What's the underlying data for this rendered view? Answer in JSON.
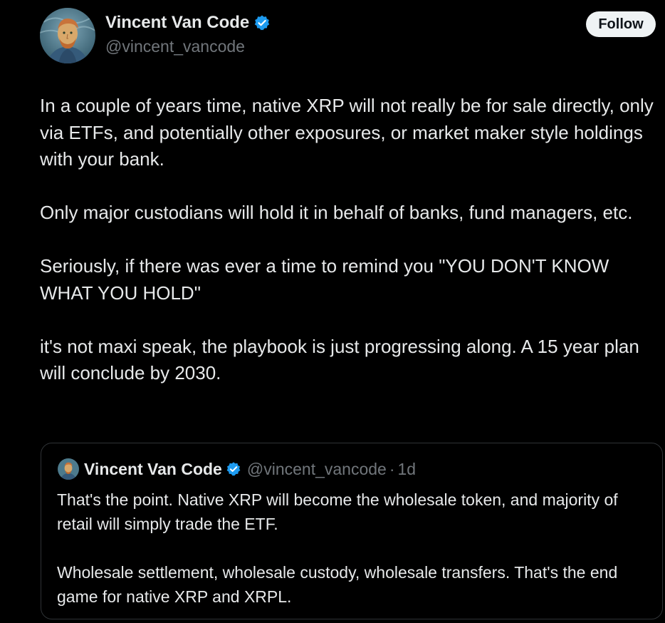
{
  "author": {
    "name": "Vincent Van Code",
    "handle": "@vincent_vancode",
    "verified_icon": "verified-badge-icon",
    "avatar_icon": "van-gogh-portrait-avatar"
  },
  "follow_button": {
    "label": "Follow"
  },
  "tweet": {
    "paragraphs": [
      "In a couple of years time, native XRP will not really be for sale directly, only via ETFs, and potentially other exposures, or market maker style holdings with your bank.",
      "Only major custodians will hold it in behalf of banks, fund managers, etc.",
      "Seriously, if there was ever a time to remind you \"YOU DON'T KNOW WHAT YOU HOLD\"",
      "it's not maxi speak, the playbook is just progressing along.  A 15 year plan will conclude by 2030."
    ]
  },
  "quoted_tweet": {
    "name": "Vincent Van Code",
    "handle": "@vincent_vancode",
    "separator": "·",
    "time": "1d",
    "paragraphs": [
      "That's the point.  Native XRP will become the wholesale token, and majority of retail will simply trade the ETF.",
      "Wholesale settlement, wholesale custody, wholesale transfers.  That's the end game for native XRP and XRPL."
    ]
  },
  "colors": {
    "background": "#000000",
    "text": "#e7e9ea",
    "secondary_text": "#71767b",
    "verified_blue": "#1d9bf0",
    "border": "#2f3336",
    "follow_bg": "#eff3f4"
  }
}
